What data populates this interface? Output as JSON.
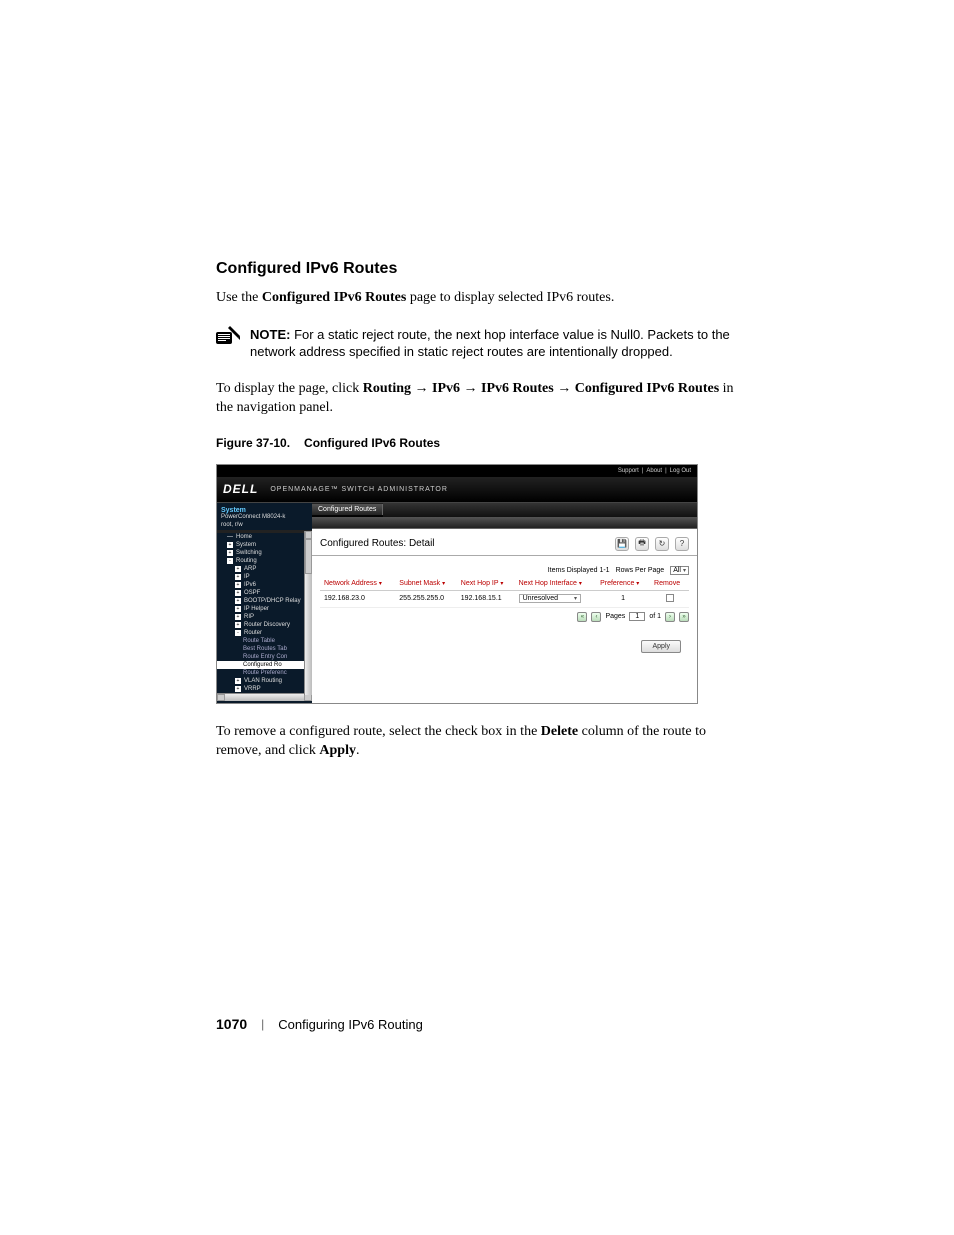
{
  "page": {
    "heading": "Configured IPv6 Routes",
    "intro_prefix": "Use the ",
    "intro_bold": "Configured IPv6 Routes",
    "intro_suffix": " page to display selected IPv6 routes.",
    "note_label": "NOTE:",
    "note_text": " For a static reject route, the next hop interface value is Null0. Packets to the network address specified in static reject routes are intentionally dropped.",
    "nav_intro_prefix": "To display the page, click ",
    "nav_path_1": "Routing",
    "nav_path_2": "IPv6",
    "nav_path_3": "IPv6 Routes",
    "nav_path_4": "Configured IPv6 Routes",
    "nav_intro_suffix": " in the navigation panel.",
    "figure_num": "Figure 37-10.",
    "figure_title": "Configured IPv6 Routes",
    "after_prefix": "To remove a configured route, select the check box in the ",
    "after_bold1": "Delete",
    "after_mid": " column of the route to remove, and click ",
    "after_bold2": "Apply",
    "after_end": "."
  },
  "screenshot": {
    "top_links": {
      "support": "Support",
      "about": "About",
      "logout": "Log Out"
    },
    "brand": "DELL",
    "brand_sub": "OPENMANAGE™ SWITCH ADMINISTRATOR",
    "nav": {
      "system_label": "System",
      "device": "PowerConnect M8024-k",
      "user": "root, r/w",
      "items": [
        {
          "label": "Home",
          "depth": 1
        },
        {
          "label": "System",
          "depth": 1,
          "box": "+"
        },
        {
          "label": "Switching",
          "depth": 1,
          "box": "+"
        },
        {
          "label": "Routing",
          "depth": 1,
          "box": "-"
        },
        {
          "label": "ARP",
          "depth": 2,
          "box": "+"
        },
        {
          "label": "IP",
          "depth": 2,
          "box": "+"
        },
        {
          "label": "IPv6",
          "depth": 2,
          "box": "+"
        },
        {
          "label": "OSPF",
          "depth": 2,
          "box": "+"
        },
        {
          "label": "BOOTP/DHCP Relay",
          "depth": 2,
          "box": "+"
        },
        {
          "label": "IP Helper",
          "depth": 2,
          "box": "+"
        },
        {
          "label": "RIP",
          "depth": 2,
          "box": "+"
        },
        {
          "label": "Router Discovery",
          "depth": 2,
          "box": "+"
        },
        {
          "label": "Router",
          "depth": 2,
          "box": "-"
        },
        {
          "label": "Route Table",
          "depth": 3
        },
        {
          "label": "Best Routes Tab",
          "depth": 3
        },
        {
          "label": "Route Entry Con",
          "depth": 3
        },
        {
          "label": "Configured Ro",
          "depth": 3,
          "highlight": true
        },
        {
          "label": "Route Preferenc",
          "depth": 3
        },
        {
          "label": "VLAN Routing",
          "depth": 2,
          "box": "+"
        },
        {
          "label": "VRRP",
          "depth": 2,
          "box": "+"
        }
      ]
    },
    "breadcrumb_tab": "Configured Routes",
    "detail_title": "Configured Routes: Detail",
    "items_displayed_label": "Items Displayed 1-1",
    "rows_per_page_label": "Rows Per Page",
    "rows_per_page_value": "All",
    "columns": {
      "network_address": "Network Address",
      "subnet_mask": "Subnet Mask",
      "next_hop_ip": "Next Hop IP",
      "next_hop_interface": "Next Hop Interface",
      "preference": "Preference",
      "remove": "Remove"
    },
    "row": {
      "network_address": "192.168.23.0",
      "subnet_mask": "255.255.255.0",
      "next_hop_ip": "192.168.15.1",
      "next_hop_interface": "Unresolved",
      "preference": "1"
    },
    "pager": {
      "pages_label": "Pages",
      "current": "1",
      "of_label": "of 1"
    },
    "apply": "Apply"
  },
  "footer": {
    "pagenum": "1070",
    "section": "Configuring IPv6 Routing"
  }
}
